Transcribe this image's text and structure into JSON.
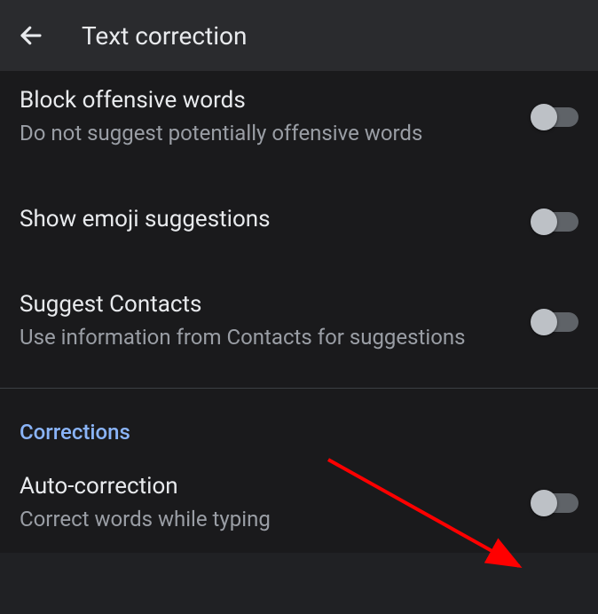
{
  "header": {
    "title": "Text correction"
  },
  "items": {
    "block_offensive": {
      "title": "Block offensive words",
      "subtitle": "Do not suggest potentially offensive words"
    },
    "emoji_suggestions": {
      "title": "Show emoji suggestions"
    },
    "suggest_contacts": {
      "title": "Suggest Contacts",
      "subtitle": "Use information from Contacts for suggestions"
    },
    "auto_correction": {
      "title": "Auto-correction",
      "subtitle": "Correct words while typing"
    }
  },
  "sections": {
    "corrections": "Corrections"
  }
}
